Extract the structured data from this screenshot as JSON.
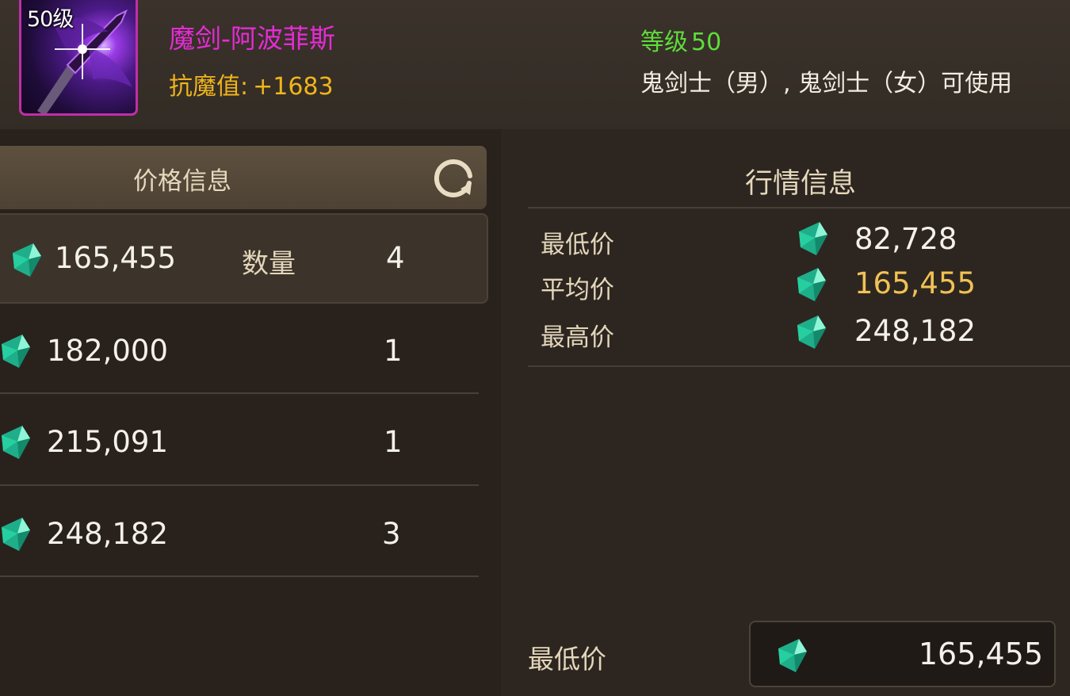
{
  "item": {
    "level_badge": "50级",
    "name": "魔剑-阿波菲斯",
    "resist_label": "抗魔值:",
    "resist_value": "+1683",
    "req_level_label": "等级",
    "req_level_value": "50",
    "usable_classes": "鬼剑士（男）, 鬼剑士（女）可使用"
  },
  "price_panel": {
    "title": "价格信息",
    "refresh_icon": "refresh-icon",
    "qty_label": "数量",
    "rows": [
      {
        "price": "165,455",
        "qty": "4",
        "selected": true
      },
      {
        "price": "182,000",
        "qty": "1",
        "selected": false
      },
      {
        "price": "215,091",
        "qty": "1",
        "selected": false
      },
      {
        "price": "248,182",
        "qty": "3",
        "selected": false
      }
    ]
  },
  "market_panel": {
    "title": "行情信息",
    "stats": [
      {
        "label": "最低价",
        "value": "82,728"
      },
      {
        "label": "平均价",
        "value": "165,455"
      },
      {
        "label": "最高价",
        "value": "248,182"
      }
    ]
  },
  "footer": {
    "label": "最低价",
    "value": "165,455",
    "currency_icon": "gem-icon"
  },
  "colors": {
    "item_name": "#e62bd5",
    "resist": "#f0b51b",
    "req_level": "#5fdc3b",
    "avg_price": "#f0c155",
    "gem": "#2fd6a4"
  }
}
